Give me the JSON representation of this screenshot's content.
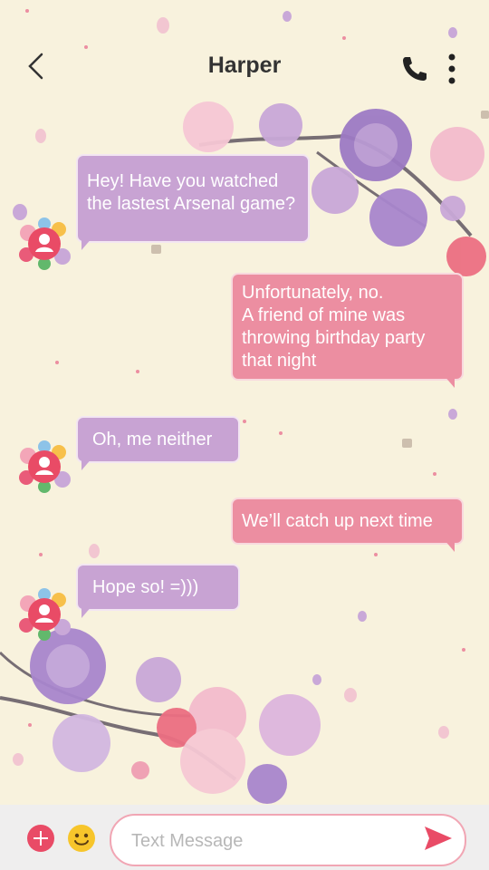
{
  "header": {
    "title": "Harper",
    "back_icon": "chevron-left-icon",
    "call_icon": "phone-icon",
    "more_icon": "more-vertical-icon"
  },
  "messages": [
    {
      "from": "in",
      "text": "Hey! Have you watched\nthe lastest Arsenal game?"
    },
    {
      "from": "out",
      "text": "Unfortunately, no.\nA friend of mine was\nthrowing birthday party\nthat night"
    },
    {
      "from": "in",
      "text": "Oh, me neither"
    },
    {
      "from": "out",
      "text": "We’ll catch up next time"
    },
    {
      "from": "in",
      "text": "Hope so! =)))"
    }
  ],
  "composer": {
    "placeholder": "Text Message",
    "add_icon": "plus-icon",
    "emoji_icon": "smiley-icon",
    "send_icon": "send-icon"
  },
  "colors": {
    "background": "#f8f2dd",
    "incoming_bubble": "#c8a3d3",
    "outgoing_bubble": "#ec8ea1",
    "accent": "#e94b66"
  }
}
